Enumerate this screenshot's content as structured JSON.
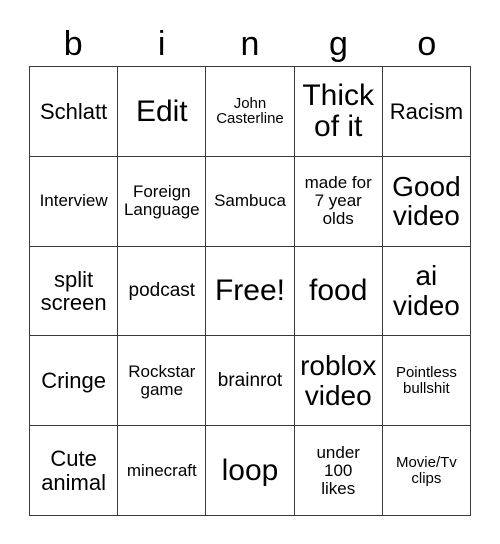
{
  "card": {
    "header_letters": [
      "b",
      "i",
      "n",
      "g",
      "o"
    ],
    "columns": 5,
    "rows": 5,
    "background_color": "#ffffff",
    "border_color": "#3a3a3a",
    "text_color": "#000000",
    "free_space_label": "Free!",
    "free_space_index": 12,
    "cells": [
      {
        "text": "Schlatt",
        "size": "fs-md"
      },
      {
        "text": "Edit",
        "size": "fs-xl"
      },
      {
        "text": "John\nCasterline",
        "size": "fs-xxs"
      },
      {
        "text": "Thick\nof it",
        "size": "fs-xl"
      },
      {
        "text": "Racism",
        "size": "fs-md"
      },
      {
        "text": "Interview",
        "size": "fs-xs"
      },
      {
        "text": "Foreign\nLanguage",
        "size": "fs-xs"
      },
      {
        "text": "Sambuca",
        "size": "fs-xs"
      },
      {
        "text": "made for\n7 year\nolds",
        "size": "fs-xs"
      },
      {
        "text": "Good\nvideo",
        "size": "fs-lg"
      },
      {
        "text": "split\nscreen",
        "size": "fs-md"
      },
      {
        "text": "podcast",
        "size": "fs-sm"
      },
      {
        "text": "Free!",
        "size": "fs-xl"
      },
      {
        "text": "food",
        "size": "fs-xl"
      },
      {
        "text": "ai\nvideo",
        "size": "fs-lg"
      },
      {
        "text": "Cringe",
        "size": "fs-md"
      },
      {
        "text": "Rockstar\ngame",
        "size": "fs-xs"
      },
      {
        "text": "brainrot",
        "size": "fs-sm"
      },
      {
        "text": "roblox\nvideo",
        "size": "fs-lg"
      },
      {
        "text": "Pointless\nbullshit",
        "size": "fs-xxs"
      },
      {
        "text": "Cute\nanimal",
        "size": "fs-md"
      },
      {
        "text": "minecraft",
        "size": "fs-xs"
      },
      {
        "text": "loop",
        "size": "fs-xl"
      },
      {
        "text": "under\n100\nlikes",
        "size": "fs-xs"
      },
      {
        "text": "Movie/Tv\nclips",
        "size": "fs-xxs"
      }
    ]
  }
}
